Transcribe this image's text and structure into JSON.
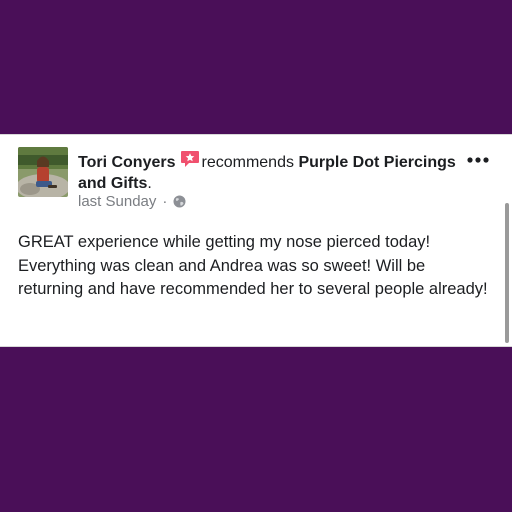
{
  "post": {
    "author_name": "Tori Conyers",
    "action_text": "recommends",
    "page_name": "Purple Dot Piercings and Gifts",
    "trailing_punct": ".",
    "timestamp": "last Sunday",
    "separator": "·",
    "privacy_icon": "globe-icon",
    "recommend_icon": "recommendation-badge-icon",
    "more_icon": "more-options-icon",
    "body": "GREAT experience while getting my nose pierced today! Everything was clean and Andrea was so sweet! Will be returning and have recommended her to several people already!"
  },
  "colors": {
    "background": "#4a0f58",
    "card": "#ffffff",
    "text": "#1c1e21",
    "meta_text": "#7a7d82",
    "badge": "#f0506e"
  }
}
